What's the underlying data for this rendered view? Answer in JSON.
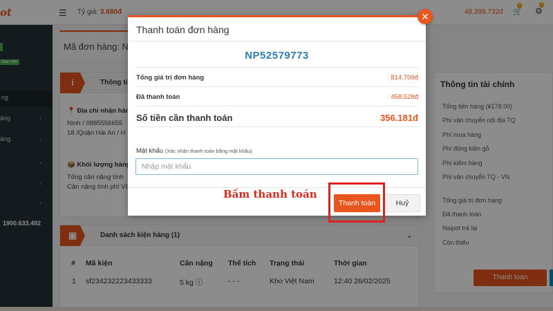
{
  "header": {
    "logo": "ot",
    "rate_label": "Tỷ giá:",
    "rate_value": "3.680đ",
    "balance": "48.399.732đ",
    "cart_count": "0",
    "notif_count": "0"
  },
  "sidebar": {
    "location": "Mai, HN",
    "active_label": "ng",
    "items": [
      {
        "label": "àng"
      },
      {
        "label": "àng"
      }
    ],
    "phone": "1900.633.492"
  },
  "main": {
    "order_label": "Mã đơn hàng: N",
    "recipient_panel": {
      "title": "Thông tin",
      "address_label": "Địa chỉ nhận hàng",
      "name_phone": "Ninh / 0885556655",
      "address": "18 /Quận Hải An / H"
    },
    "weight_panel": {
      "title": "Khối lượng hàng",
      "line1": "Tổng cân nặng tính",
      "line2": "Cân nặng tính phí VC"
    },
    "package_list": {
      "title": "Danh sách kiện hàng (1)",
      "columns": [
        "#",
        "Mã kiện",
        "Cân nặng",
        "Thể tích",
        "Trạng thái",
        "Thời gian"
      ],
      "rows": [
        {
          "index": "1",
          "code": "sf234232223433333",
          "weight": "5 kg",
          "volume": "- - -",
          "status": "Kho Việt Nam",
          "time": "12:40 26/02/2025"
        }
      ]
    }
  },
  "finance": {
    "title": "Thông tin tài chính",
    "rows": [
      "Tổng tiền hàng (¥178.00)",
      "Phí vận chuyển nội địa TQ",
      "Phí mua hàng",
      "Phí đóng kiện gỗ",
      "Phí kiểm hàng",
      "Phí vận chuyển TQ - VN",
      "Tổng giá trị đơn hàng",
      "Đã thanh toán",
      "Naipot trả lại",
      "Còn thiếu"
    ],
    "pay_button": "Thanh toán"
  },
  "modal": {
    "title": "Thanh toán đơn hàng",
    "order_code": "NP52579773",
    "total_label": "Tổng giá trị đơn hàng",
    "total_value": "814.709đ",
    "paid_label": "Đã thanh toán",
    "paid_value": "458.528đ",
    "due_label": "Số tiền cần thanh toán",
    "due_value": "356.181đ",
    "password_label": "Mật khẩu",
    "password_hint": "(Xác nhận thanh toán bằng mật khẩu)",
    "password_placeholder": "Nhập mật khẩu",
    "pay_button": "Thanh toán",
    "cancel_button": "Huỷ",
    "close_symbol": "✕"
  },
  "annotation": {
    "text": "Bấm thanh toán",
    "color": "#d62a1e"
  },
  "colors": {
    "accent": "#e8551d",
    "order_code": "#2e7bb5",
    "sidebar": "#263238"
  }
}
